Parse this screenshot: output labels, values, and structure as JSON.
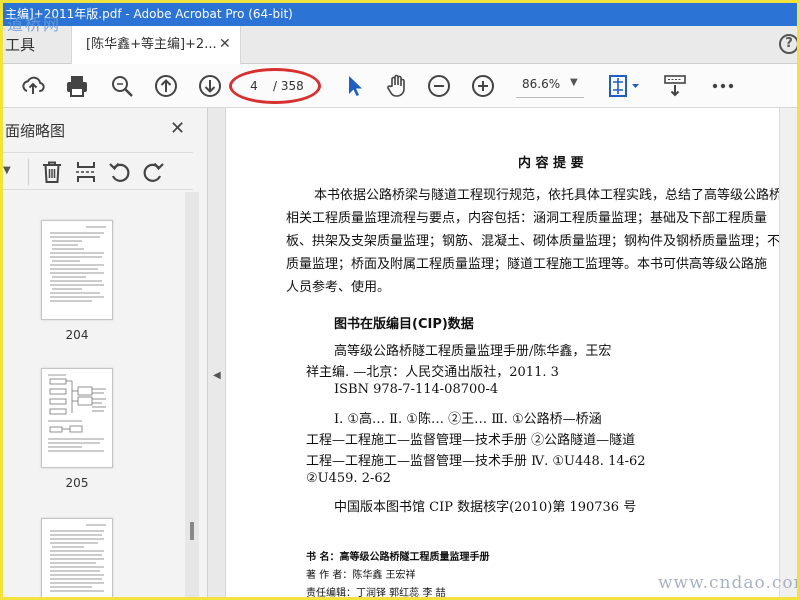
{
  "window": {
    "title": "主编]+2011年版.pdf - Adobe Acrobat Pro (64-bit)"
  },
  "watermarks": {
    "top": "道桥网",
    "bottom": "www.cndao.com"
  },
  "tabs": {
    "tools_label": "工具",
    "doc_label": "[陈华鑫+等主编]+2...",
    "close_icon": "close-icon",
    "help_label": "?"
  },
  "toolbar": {
    "icons": [
      "upload-icon",
      "print-icon",
      "zoom-search-icon",
      "arrow-up-icon",
      "arrow-down-icon",
      "select-arrow-icon",
      "hand-icon",
      "zoom-out-icon",
      "zoom-in-icon",
      "fit-page-icon",
      "scroll-mode-icon",
      "more-icon"
    ],
    "page_current": "4",
    "page_total": "/ 358",
    "zoom": "86.6%",
    "accent": "#1f5fbf",
    "highlight": "#d83030"
  },
  "panel": {
    "title": "面缩略图",
    "tools": [
      "delete-icon",
      "insert-page-icon",
      "rotate-left-icon",
      "rotate-right-icon"
    ],
    "thumbnails": [
      {
        "label": "204"
      },
      {
        "label": "205"
      }
    ]
  },
  "document": {
    "heading": "内    容    提    要",
    "summary_lines": [
      "本书依据公路桥梁与隧道工程现行规范，依托具体工程实践，总结了高等级公路桥",
      "相关工程质量监理流程与要点，内容包括：涵洞工程质量监理；基础及下部工程质量",
      "板、拱架及支架质量监理；钢筋、混凝土、砌体质量监理；钢构件及钢桥质量监理；不同",
      "质量监理；桥面及附属工程质量监理；隧道工程施工监理等。本书可供高等级公路施",
      "人员参考、使用。"
    ],
    "cip_heading": "图书在版编目(CIP)数据",
    "cip_lines": [
      "高等级公路桥隧工程质量监理手册/陈华鑫，王宏",
      "祥主编. —北京：人民交通出版社，2011. 3",
      "ISBN  978-7-114-08700-4"
    ],
    "class_lines": [
      "Ⅰ. ①高…   Ⅱ. ①陈…   ②王…   Ⅲ. ①公路桥—桥涵",
      "工程—工程施工—监督管理—技术手册  ②公路隧道—隧道",
      "工程—工程施工—监督管理—技术手册   Ⅳ. ①U448. 14-62",
      "②U459. 2-62"
    ],
    "cip_number": "中国版本图书馆 CIP 数据核字(2010)第 190736 号",
    "credits": [
      "书      名：高等级公路桥隧工程质量监理手册",
      "著  作  者：陈华鑫    王宏祥",
      "责任编辑：丁润铎    郭红蕊    李    喆"
    ]
  }
}
